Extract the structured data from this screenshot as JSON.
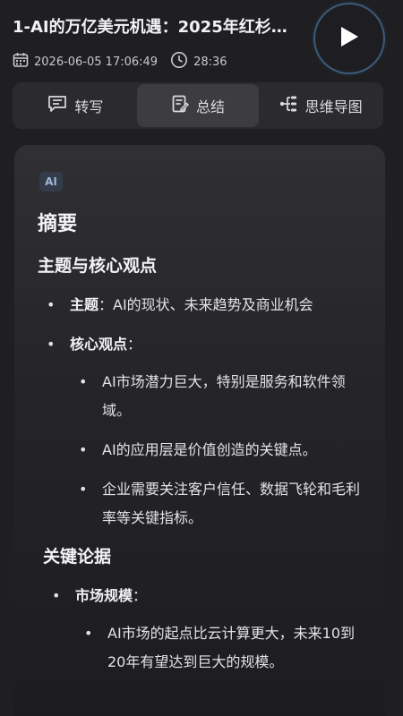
{
  "header": {
    "title": "1-AI的万亿美元机遇：2025年红杉…",
    "date": "2026-06-05 17:06:49",
    "duration": "28:36"
  },
  "tabs": [
    {
      "label": "转写",
      "icon": "transcript-icon",
      "active": false
    },
    {
      "label": "总结",
      "icon": "summary-icon",
      "active": true
    },
    {
      "label": "思维导图",
      "icon": "mindmap-icon",
      "active": false
    }
  ],
  "summary": {
    "badge": "AI",
    "heading": "摘要",
    "section1": {
      "title": "主题与核心观点",
      "topic_label": "主题",
      "topic_text": "：AI的现状、未来趋势及商业机会",
      "core_label": "核心观点",
      "core_colon": "：",
      "core_points": [
        "AI市场潜力巨大，特别是服务和软件领域。",
        "AI的应用层是价值创造的关键点。",
        "企业需要关注客户信任、数据飞轮和毛利率等关键指标。"
      ]
    },
    "section2": {
      "title": "关键论据",
      "market_label": "市场规模",
      "market_colon": "：",
      "market_points": [
        "AI市场的起点比云计算更大，未来10到20年有望达到巨大的规模。"
      ]
    }
  },
  "colors": {
    "background": "#1f1f21",
    "card": "#2a2a2d",
    "accent_ring": "#3d5a7a"
  }
}
